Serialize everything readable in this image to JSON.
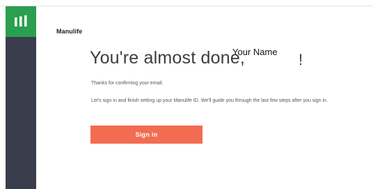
{
  "app": {
    "brand": "Manulife"
  },
  "main": {
    "headline": "You're almost done,",
    "user_name": "Your Name",
    "exclamation": "!",
    "confirm_text": "Thanks for confirming your email.",
    "instructions": "Let's sign in and finish setting up your Manulife ID. We'll guide you through the last few steps after you sign in.",
    "signin_label": "Sign in"
  },
  "colors": {
    "sidebar": "#3a3d4b",
    "logo_bg": "#2a9f4f",
    "button": "#f26c52"
  },
  "icons": {
    "logo": "manulife-logo-icon"
  }
}
